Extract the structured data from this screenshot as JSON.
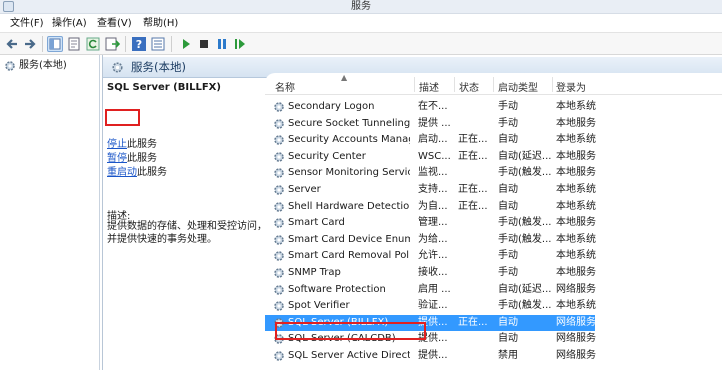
{
  "window": {
    "title": "服务"
  },
  "menu": [
    {
      "label": "文件(F)"
    },
    {
      "label": "操作(A)"
    },
    {
      "label": "查看(V)"
    },
    {
      "label": "帮助(H)"
    }
  ],
  "toolbar": {
    "buttons": [
      "back-icon",
      "forward-icon",
      "console-tree-icon",
      "properties-icon",
      "refresh-icon",
      "export-icon",
      "help-icon",
      "details-icon",
      "play-icon",
      "stop-icon",
      "pause-icon",
      "restart-icon"
    ]
  },
  "tree": {
    "root_label": "服务(本地)"
  },
  "pane": {
    "title": "服务(本地)"
  },
  "detail": {
    "service_name": "SQL Server (BILLFX)",
    "actions": [
      {
        "link": "停止",
        "rest": "此服务"
      },
      {
        "link": "暂停",
        "rest": "此服务"
      },
      {
        "link": "重启动",
        "rest": "此服务"
      }
    ],
    "description_label": "描述:",
    "description": "提供数据的存储、处理和受控访问，并提供快速的事务处理。"
  },
  "columns": {
    "name": "名称",
    "desc": "描述",
    "status": "状态",
    "startup": "启动类型",
    "logon": "登录为"
  },
  "rows": [
    {
      "name": "Secondary Logon",
      "desc": "在不...",
      "status": "",
      "startup": "手动",
      "logon": "本地系统"
    },
    {
      "name": "Secure Socket Tunneling ...",
      "desc": "提供 ...",
      "status": "",
      "startup": "手动",
      "logon": "本地服务"
    },
    {
      "name": "Security Accounts Manag...",
      "desc": "启动...",
      "status": "正在...",
      "startup": "自动",
      "logon": "本地系统"
    },
    {
      "name": "Security Center",
      "desc": "WSC...",
      "status": "正在...",
      "startup": "自动(延迟...",
      "logon": "本地服务"
    },
    {
      "name": "Sensor Monitoring Service",
      "desc": "监视...",
      "status": "",
      "startup": "手动(触发...",
      "logon": "本地服务"
    },
    {
      "name": "Server",
      "desc": "支持...",
      "status": "正在...",
      "startup": "自动",
      "logon": "本地系统"
    },
    {
      "name": "Shell Hardware Detection",
      "desc": "为自...",
      "status": "正在...",
      "startup": "自动",
      "logon": "本地系统"
    },
    {
      "name": "Smart Card",
      "desc": "管理...",
      "status": "",
      "startup": "手动(触发...",
      "logon": "本地服务"
    },
    {
      "name": "Smart Card Device Enum...",
      "desc": "为给...",
      "status": "",
      "startup": "手动(触发...",
      "logon": "本地系统"
    },
    {
      "name": "Smart Card Removal Poli...",
      "desc": "允许...",
      "status": "",
      "startup": "手动",
      "logon": "本地系统"
    },
    {
      "name": "SNMP Trap",
      "desc": "接收...",
      "status": "",
      "startup": "手动",
      "logon": "本地服务"
    },
    {
      "name": "Software Protection",
      "desc": "启用 ...",
      "status": "",
      "startup": "自动(延迟...",
      "logon": "网络服务"
    },
    {
      "name": "Spot Verifier",
      "desc": "验证...",
      "status": "",
      "startup": "手动(触发...",
      "logon": "本地系统"
    },
    {
      "name": "SQL Server (BILLFX)",
      "desc": "提供...",
      "status": "正在...",
      "startup": "自动",
      "logon": "网络服务",
      "selected": true
    },
    {
      "name": "SQL Server (CALCDB)",
      "desc": "提供...",
      "status": "",
      "startup": "自动",
      "logon": "网络服务"
    },
    {
      "name": "SQL Server Active Direct...",
      "desc": "提供...",
      "status": "",
      "startup": "禁用",
      "logon": "网络服务"
    }
  ],
  "colors": {
    "selection": "#3399ff",
    "highlight_box": "#e02020",
    "link": "#1a55c8"
  }
}
